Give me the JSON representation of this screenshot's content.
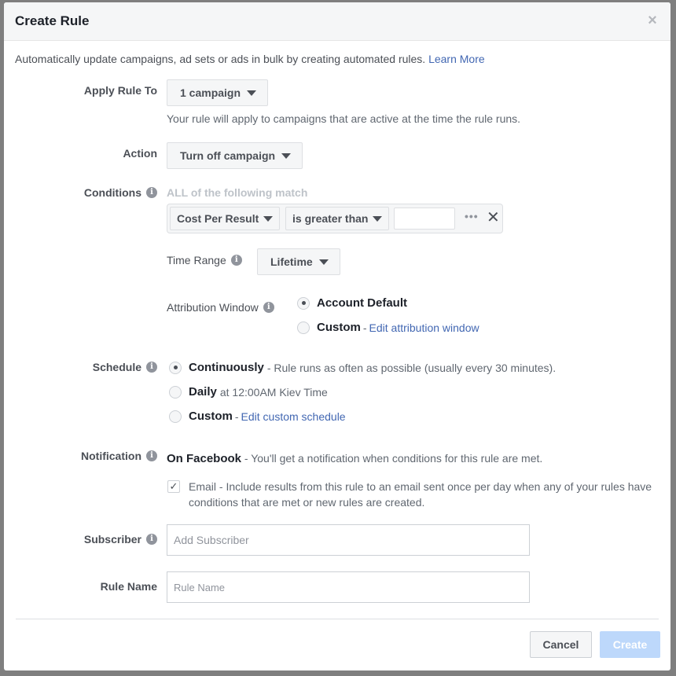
{
  "modal": {
    "title": "Create Rule",
    "close_icon": "close-icon",
    "intro_text": "Automatically update campaigns, ad sets or ads in bulk by creating automated rules.",
    "learn_more_link": "Learn More"
  },
  "apply_rule_to": {
    "label": "Apply Rule To",
    "selected": "1 campaign",
    "help_text": "Your rule will apply to campaigns that are active at the time the rule runs."
  },
  "action": {
    "label": "Action",
    "selected": "Turn off campaign"
  },
  "conditions": {
    "label": "Conditions",
    "match_heading": "ALL of the following match",
    "items": [
      {
        "metric": "Cost Per Result",
        "operator": "is greater than",
        "value": ""
      }
    ],
    "more_icon": "ellipsis-icon",
    "remove_icon": "close-icon",
    "time_range": {
      "label": "Time Range",
      "selected": "Lifetime"
    },
    "attribution_window": {
      "label": "Attribution Window",
      "options": [
        {
          "label": "Account Default",
          "checked": true
        },
        {
          "label": "Custom",
          "link": "Edit attribution window",
          "checked": false
        }
      ]
    }
  },
  "schedule": {
    "label": "Schedule",
    "options": [
      {
        "label": "Continuously",
        "description": "- Rule runs as often as possible (usually every 30 minutes).",
        "checked": true
      },
      {
        "label": "Daily",
        "description": "at 12:00AM Kiev Time",
        "checked": false
      },
      {
        "label": "Custom",
        "link": "Edit custom schedule",
        "checked": false
      }
    ]
  },
  "notification": {
    "label": "Notification",
    "on_facebook_label": "On Facebook",
    "on_facebook_desc": "- You'll get a notification when conditions for this rule are met.",
    "email_checked": true,
    "email_text": "Email - Include results from this rule to an email sent once per day when any of your rules have conditions that are met or new rules are created."
  },
  "subscriber": {
    "label": "Subscriber",
    "placeholder": "Add Subscriber",
    "value": ""
  },
  "rule_name": {
    "label": "Rule Name",
    "placeholder": "Rule Name",
    "value": ""
  },
  "footer": {
    "cancel_label": "Cancel",
    "create_label": "Create"
  },
  "colors": {
    "link": "#4267b2",
    "primary_disabled": "#bdd8fb",
    "header_bg": "#f5f6f7"
  }
}
